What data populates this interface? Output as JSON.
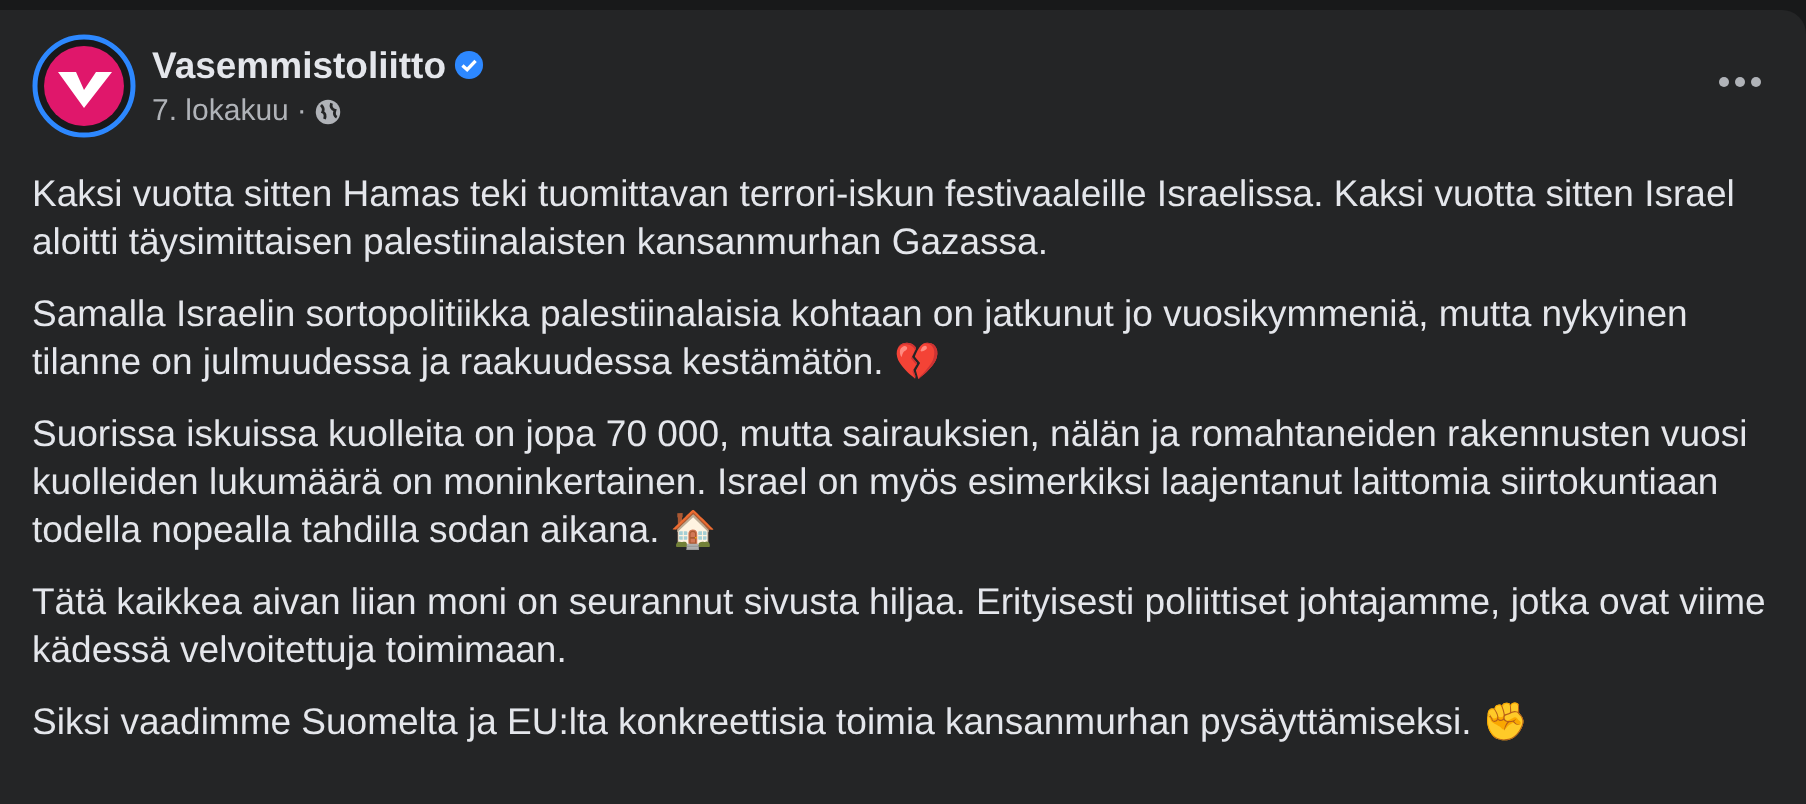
{
  "post": {
    "author": "Vasemmistoliitto",
    "verified": true,
    "date": "7. lokakuu",
    "separator": "·",
    "paragraphs": [
      {
        "text": "Kaksi vuotta sitten Hamas teki tuomittavan terrori-iskun festivaaleille Israelissa. Kaksi vuotta sitten Israel aloitti täysimittaisen palestiinalaisten kansanmurhan Gazassa."
      },
      {
        "text": "Samalla Israelin sortopolitiikka palestiinalaisia kohtaan on jatkunut jo vuosikymmeniä, mutta nykyinen tilanne on julmuudessa ja raakuudessa kestämätön. 💔"
      },
      {
        "text": "Suorissa iskuissa kuolleita on jopa 70 000, mutta sairauksien, nälän ja romahtaneiden rakennusten vuosi kuolleiden lukumäärä on moninkertainen. Israel on myös esimerkiksi laajentanut laittomia siirtokuntiaan todella nopealla tahdilla sodan aikana. 🏠"
      },
      {
        "text": "Tätä kaikkea aivan liian moni on seurannut sivusta hiljaa. Erityisesti poliittiset johtajamme, jotka ovat viime kädessä velvoitettuja toimimaan."
      },
      {
        "text": "Siksi vaadimme Suomelta ja EU:lta konkreettisia toimia kansanmurhan pysäyttämiseksi. ✊"
      }
    ]
  }
}
